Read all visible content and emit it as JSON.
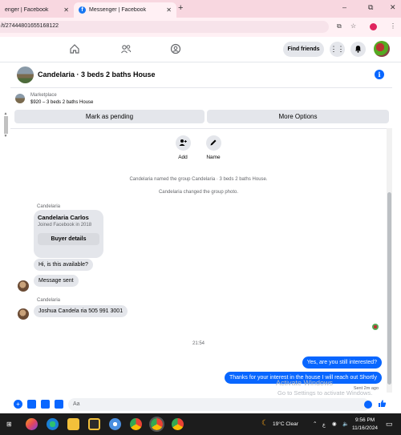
{
  "browser": {
    "tabs": [
      {
        "title": "enger | Facebook"
      },
      {
        "title": "Messenger | Facebook"
      }
    ],
    "url": "/t/27444801655168122",
    "new_tab": "+",
    "controls": {
      "minimize": "–",
      "maximize": "⧉",
      "close": "✕"
    }
  },
  "nav": {
    "find_friends": "Find friends"
  },
  "chat": {
    "title": "Candelaria · 3 beds 2 baths House",
    "marketplace_label": "Marketplace",
    "listing": "$920 – 3 beds 2 baths House",
    "mark_pending": "Mark as pending",
    "more_options": "More Options",
    "controls": [
      {
        "label": "Add"
      },
      {
        "label": "Name"
      }
    ],
    "system_messages": [
      "Candelaria named the group Candelaria · 3 beds 2 baths House.",
      "Candelaria changed the group photo."
    ],
    "sender_name": "Candelaria",
    "card": {
      "name": "Candelaria Carlos",
      "subtitle": "Joined Facebook in 2018",
      "button": "Buyer details"
    },
    "incoming": [
      "Hi, is this available?",
      "Message sent",
      "Joshua Candela ria 505 991 3001"
    ],
    "timestamp": "21:54",
    "outgoing": [
      "Yes, are you still interested?",
      "Thanks for your interest in the house I will reach out Shortly"
    ],
    "sent_status": "Sent 2m ago",
    "composer_placeholder": "Aa"
  },
  "watermark": {
    "line1": "Activate Windows",
    "line2": "Go to Settings to activate Windows."
  },
  "taskbar": {
    "weather": "19°C  Clear",
    "time": "9:56 PM",
    "date": "11/16/2024"
  },
  "colors": {
    "brand_blue": "#0866ff",
    "tab_bar": "#f8d7e0",
    "bubble_in": "#e4e6eb",
    "taskbar": "#1c1c1c"
  }
}
